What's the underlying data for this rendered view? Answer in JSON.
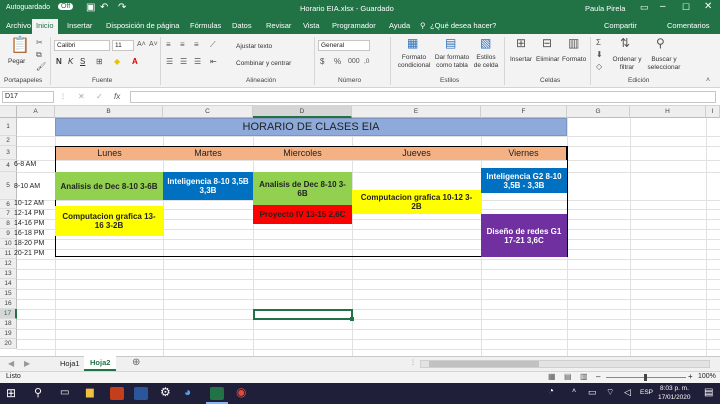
{
  "titlebar": {
    "autosave": "Autoguardado",
    "autosave_state": "Off",
    "doc_title": "Horario EIA.xlsx  -  Guardado",
    "user": "Paula Pirela"
  },
  "ribbon_tabs": [
    "Archivo",
    "Inicio",
    "Insertar",
    "Disposición de página",
    "Fórmulas",
    "Datos",
    "Revisar",
    "Vista",
    "Programador",
    "Ayuda"
  ],
  "tell_me": "¿Qué desea hacer?",
  "share": "Compartir",
  "comments": "Comentarios",
  "ribbon": {
    "paste": "Pegar",
    "clipboard_group": "Portapapeles",
    "font_name": "Calibri",
    "font_size": "11",
    "font_group": "Fuente",
    "wrap": "Ajustar texto",
    "merge": "Combinar y centrar",
    "align_group": "Alineación",
    "number_format": "General",
    "number_group": "Número",
    "cond_format": "Formato condicional",
    "format_table": "Dar formato como tabla",
    "cell_styles": "Estilos de celda",
    "styles_group": "Estilos",
    "insert": "Insertar",
    "delete": "Eliminar",
    "format": "Formato",
    "cells_group": "Celdas",
    "sort": "Ordenar y filtrar",
    "find": "Buscar y seleccionar",
    "edit_group": "Edición",
    "bold": "N",
    "italic": "K",
    "underline": "S"
  },
  "formula": {
    "name_box": "D17",
    "fx": "fx",
    "content": ""
  },
  "columns": [
    "A",
    "B",
    "C",
    "D",
    "E",
    "F",
    "G",
    "H",
    "I"
  ],
  "rows": [
    "1",
    "2",
    "3",
    "4",
    "5",
    "6",
    "7",
    "8",
    "9",
    "10",
    "11",
    "12",
    "13",
    "14",
    "15",
    "16",
    "17",
    "18",
    "19",
    "20"
  ],
  "schedule": {
    "title": "HORARIO DE CLASES EIA",
    "days": [
      "Lunes",
      "Martes",
      "Miercoles",
      "Jueves",
      "Viernes"
    ],
    "times": [
      "6-8 AM",
      "8-10 AM",
      "10-12 AM",
      "12-14 PM",
      "14-16 PM",
      "16-18 PM",
      "18-20 PM",
      "20-21 PM"
    ],
    "classes": {
      "lunes_1": "Analisis de Dec 8-10 3-6B",
      "lunes_2": "Computacion grafica 13-16 3-2B",
      "martes_1": "Inteligencia 8-10 3,5B 3,3B",
      "miercoles_1": "Analisis de Dec 8-10 3-6B",
      "miercoles_2": "Proyecto IV 13-15 2,6C",
      "jueves_1": "Computacion grafica 10-12 3-2B",
      "viernes_1": "Inteligencia G2 8-10 3,5B - 3,3B",
      "viernes_2": "Diseño de redes G1 17-21 3,6C"
    }
  },
  "colors": {
    "excel_green": "#217346",
    "title_blue": "#8eaadb",
    "header_orange": "#f4b183",
    "green": "#92d050",
    "yellow": "#ffff00",
    "blue": "#0070c0",
    "red": "#ff0000",
    "purple": "#7030a0"
  },
  "sheets": [
    "Hoja1",
    "Hoja2"
  ],
  "active_sheet": "Hoja2",
  "status": {
    "mode": "Listo",
    "zoom": "100%"
  },
  "taskbar": {
    "time": "8:03 p. m.",
    "date": "17/01/2020",
    "lang": "ESP"
  }
}
